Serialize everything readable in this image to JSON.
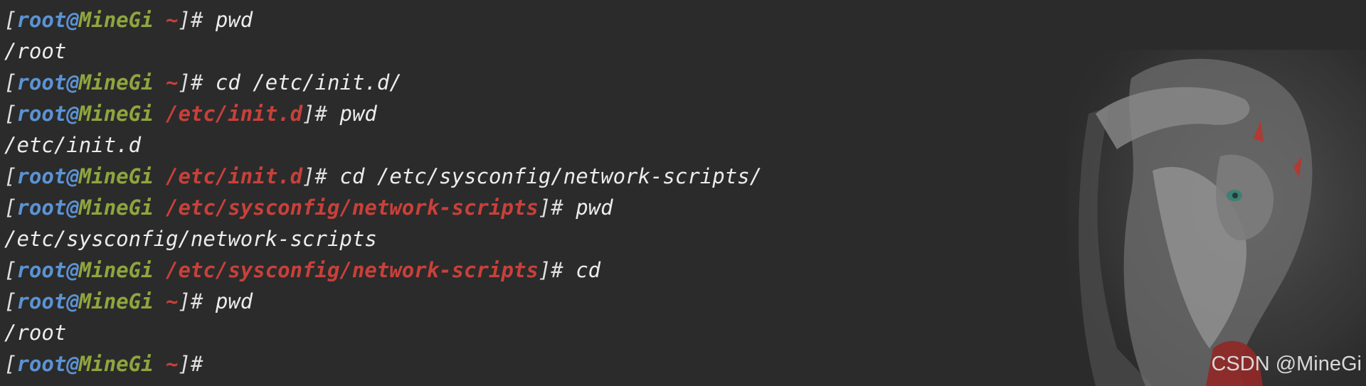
{
  "prompt": {
    "open_bracket": "[",
    "user": "root",
    "at": "@",
    "host": "MineGi",
    "close_bracket": "]",
    "symbol": "#"
  },
  "lines": [
    {
      "type": "prompt",
      "path": "~",
      "command": "pwd"
    },
    {
      "type": "output",
      "text": "/root"
    },
    {
      "type": "prompt",
      "path": "~",
      "command": "cd /etc/init.d/"
    },
    {
      "type": "prompt",
      "path": "/etc/init.d",
      "command": "pwd"
    },
    {
      "type": "output",
      "text": "/etc/init.d"
    },
    {
      "type": "prompt",
      "path": "/etc/init.d",
      "command": "cd /etc/sysconfig/network-scripts/"
    },
    {
      "type": "prompt",
      "path": "/etc/sysconfig/network-scripts",
      "command": "pwd"
    },
    {
      "type": "output",
      "text": "/etc/sysconfig/network-scripts"
    },
    {
      "type": "prompt",
      "path": "/etc/sysconfig/network-scripts",
      "command": "cd"
    },
    {
      "type": "prompt",
      "path": "~",
      "command": "pwd"
    },
    {
      "type": "output",
      "text": "/root"
    },
    {
      "type": "prompt",
      "path": "~",
      "command": ""
    }
  ],
  "watermark": "CSDN @MineGi",
  "colors": {
    "background": "#2b2b2b",
    "user": "#5b93d4",
    "host": "#8fa53e",
    "path": "#c9403a",
    "text": "#ececec"
  },
  "background_image": "anime-girl-wallpaper"
}
